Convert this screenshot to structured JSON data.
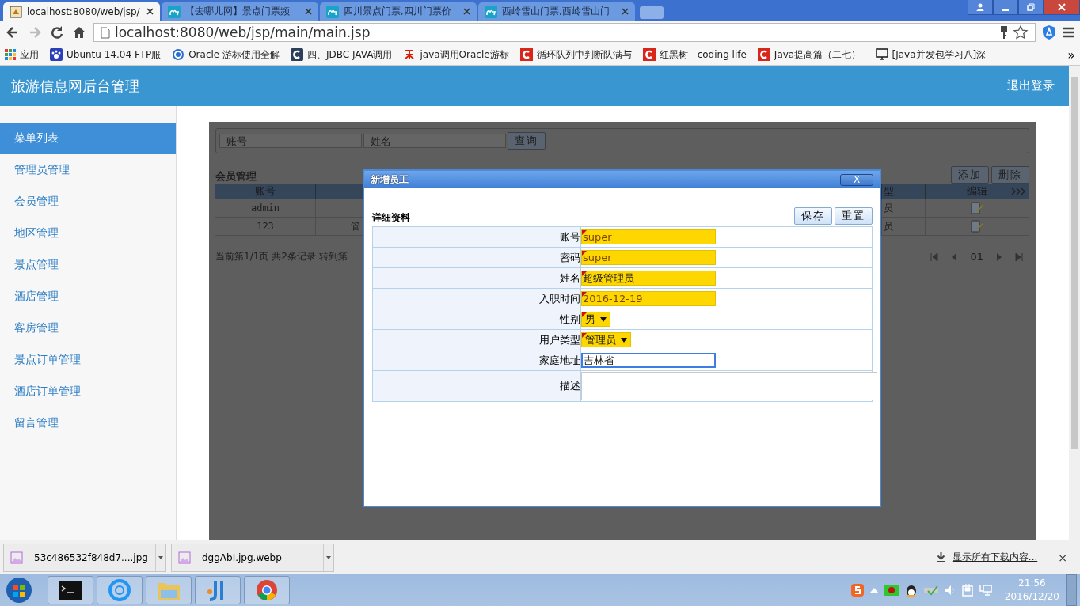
{
  "browser": {
    "tabs": [
      {
        "title": "localhost:8080/web/jsp/",
        "kind": "doc",
        "selected": true
      },
      {
        "title": "【去哪儿网】景点门票频",
        "kind": "camel",
        "selected": false
      },
      {
        "title": "四川景点门票,四川门票价",
        "kind": "camel",
        "selected": false
      },
      {
        "title": "西岭雪山门票,西岭雪山门",
        "kind": "camel",
        "selected": false
      }
    ],
    "address": "localhost:8080/web/jsp/main/main.jsp",
    "bookmarks": [
      {
        "label": "应用",
        "kind": "apps"
      },
      {
        "label": "Ubuntu 14.04 FTP服",
        "kind": "paw"
      },
      {
        "label": "Oracle 游标使用全解",
        "kind": "ring"
      },
      {
        "label": "四、JDBC JAVA调用",
        "kind": "cdark"
      },
      {
        "label": "java调用Oracle游标",
        "kind": "redmark"
      },
      {
        "label": "循环队列中判断队满与",
        "kind": "cred"
      },
      {
        "label": "红黑树 - coding life",
        "kind": "cred"
      },
      {
        "label": "Java提高篇（二七）-",
        "kind": "cred"
      },
      {
        "label": "[Java并发包学习八]深",
        "kind": "monitor"
      }
    ],
    "bookmarks_more": "»"
  },
  "header": {
    "title": "旅游信息网后台管理",
    "logout": "退出登录"
  },
  "sidebar": {
    "items": [
      {
        "label": "菜单列表",
        "selected": true
      },
      {
        "label": "管理员管理",
        "selected": false
      },
      {
        "label": "会员管理",
        "selected": false
      },
      {
        "label": "地区管理",
        "selected": false
      },
      {
        "label": "景点管理",
        "selected": false
      },
      {
        "label": "酒店管理",
        "selected": false
      },
      {
        "label": "客房管理",
        "selected": false
      },
      {
        "label": "景点订单管理",
        "selected": false
      },
      {
        "label": "酒店订单管理",
        "selected": false
      },
      {
        "label": "留言管理",
        "selected": false
      }
    ]
  },
  "search": {
    "fields": [
      {
        "placeholder": "账号"
      },
      {
        "placeholder": "姓名"
      }
    ],
    "button": "查询"
  },
  "members": {
    "title": "会员管理",
    "buttons": [
      "添加",
      "删除"
    ],
    "columns": [
      "账号",
      "型",
      "编辑"
    ],
    "rows": [
      {
        "account": "admin",
        "type": "员"
      },
      {
        "account": "123",
        "name": "管",
        "type": "员"
      }
    ],
    "paging": {
      "summary": "当前第1/1页 共2条记录 转到第",
      "page": "01"
    }
  },
  "dialog": {
    "title": "新增员工",
    "close": "X",
    "section": "详细资料",
    "buttons": [
      "保存",
      "重置"
    ],
    "fields": [
      {
        "label": "账号",
        "value": "super",
        "kind": "text",
        "required": true,
        "focused": false
      },
      {
        "label": "密码",
        "value": "super",
        "kind": "text",
        "required": true,
        "focused": false
      },
      {
        "label": "姓名",
        "value": "超级管理员",
        "kind": "text",
        "required": true,
        "focused": false
      },
      {
        "label": "入职时间",
        "value": "2016-12-19",
        "kind": "text",
        "required": true,
        "focused": false
      },
      {
        "label": "性别",
        "value": "男",
        "kind": "select",
        "required": true,
        "focused": false
      },
      {
        "label": "用户类型",
        "value": "管理员",
        "kind": "select",
        "required": true,
        "focused": false
      },
      {
        "label": "家庭地址",
        "value": "吉林省",
        "kind": "text",
        "required": false,
        "focused": true
      },
      {
        "label": "描述",
        "kind": "textarea",
        "required": false,
        "focused": false
      }
    ]
  },
  "downloads": {
    "items": [
      "53c486532f848d7....jpg",
      "dggAbI.jpg.webp"
    ],
    "show_all": "显示所有下载内容...",
    "close": "×"
  },
  "taskbar": {
    "time": "21:56",
    "date": "2016/12/20"
  }
}
